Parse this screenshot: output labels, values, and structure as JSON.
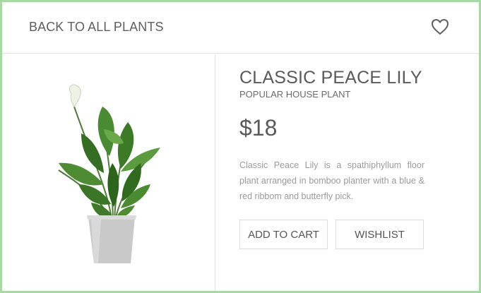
{
  "header": {
    "back_label": "BACK TO ALL PLANTS",
    "favorite_icon": "heart-icon"
  },
  "product": {
    "name": "CLASSIC PEACE LILY",
    "category": "POPULAR HOUSE PLANT",
    "price": "$18",
    "description": "Classic Peace Lily is a spathiphyllum floor plant arranged in bomboo planter with a blue & red ribbom and butterfly pick.",
    "image_icon": "plant-photo"
  },
  "actions": {
    "add_to_cart_label": "ADD TO CART",
    "wishlist_label": "WISHLIST"
  },
  "colors": {
    "border_accent": "#a8d9a4",
    "text": "#5a5a5a",
    "muted_text": "#9b9b9b",
    "divider": "#e3e3e3"
  }
}
